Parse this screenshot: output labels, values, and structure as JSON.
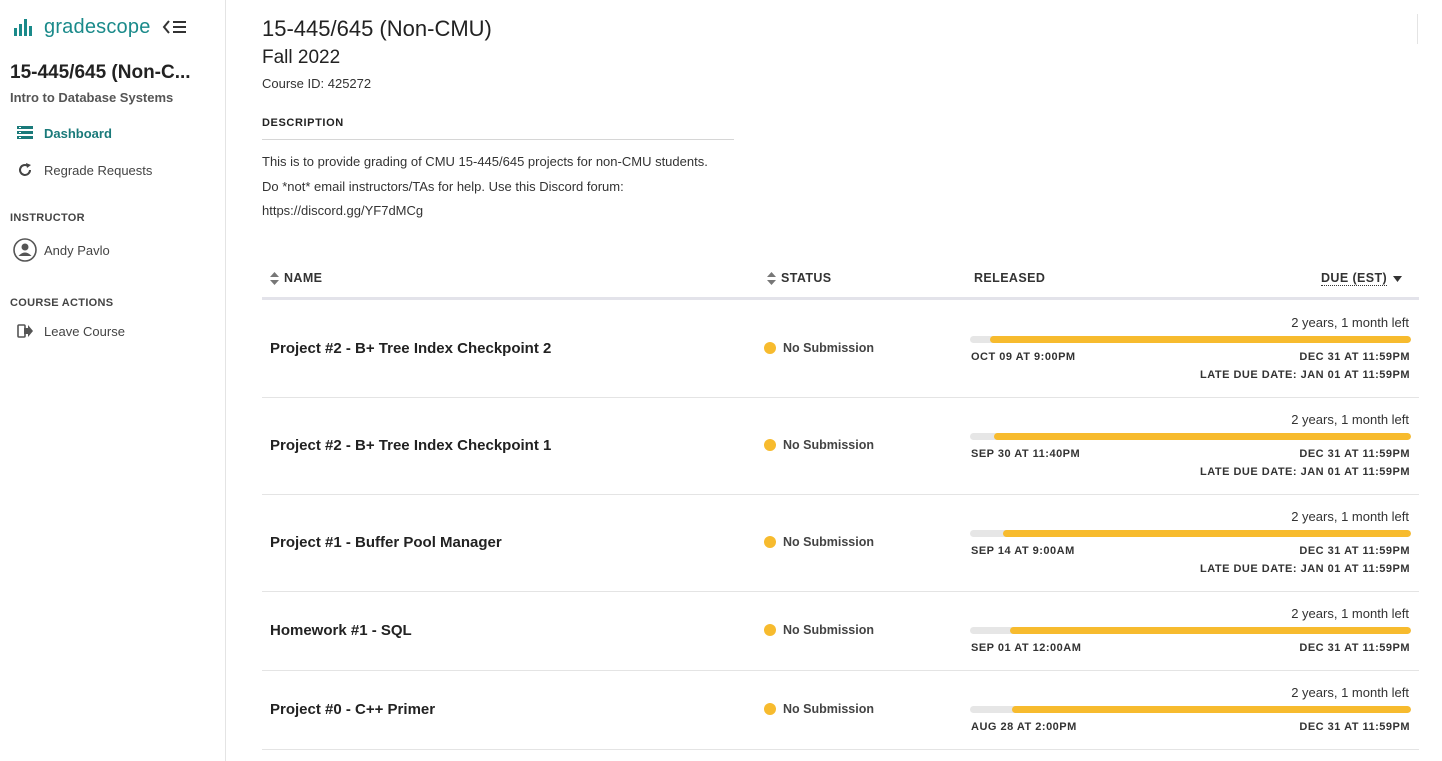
{
  "brand": {
    "name": "gradescope"
  },
  "sidebar": {
    "course_title": "15-445/645 (Non-C...",
    "course_subtitle": "Intro to Database Systems",
    "nav": [
      {
        "label": "Dashboard",
        "icon": "dashboard-icon",
        "active": true
      },
      {
        "label": "Regrade Requests",
        "icon": "refresh-icon",
        "active": false
      }
    ],
    "instructor_heading": "INSTRUCTOR",
    "instructor_name": "Andy Pavlo",
    "actions_heading": "COURSE ACTIONS",
    "leave_label": "Leave Course"
  },
  "course": {
    "title": "15-445/645 (Non-CMU)",
    "term": "Fall 2022",
    "course_id": "Course ID: 425272",
    "description_heading": "DESCRIPTION",
    "description": "This is to provide grading of CMU 15-445/645 projects for non-CMU students. Do *not* email instructors/TAs for help. Use this Discord forum: https://discord.gg/YF7dMCg"
  },
  "table": {
    "headers": {
      "name": "NAME",
      "status": "STATUS",
      "released": "RELEASED",
      "due": "DUE (EST)"
    },
    "rows": [
      {
        "name": "Project #2 - B+ Tree Index Checkpoint 2",
        "status": "No Submission",
        "time_left": "2 years, 1 month left",
        "released": "OCT 09 AT 9:00PM",
        "due": "DEC 31 AT 11:59PM",
        "late_due": "LATE DUE DATE: JAN 01 AT 11:59PM",
        "elapsed_fraction": 0.045
      },
      {
        "name": "Project #2 - B+ Tree Index Checkpoint 1",
        "status": "No Submission",
        "time_left": "2 years, 1 month left",
        "released": "SEP 30 AT 11:40PM",
        "due": "DEC 31 AT 11:59PM",
        "late_due": "LATE DUE DATE: JAN 01 AT 11:59PM",
        "elapsed_fraction": 0.055
      },
      {
        "name": "Project #1 - Buffer Pool Manager",
        "status": "No Submission",
        "time_left": "2 years, 1 month left",
        "released": "SEP 14 AT 9:00AM",
        "due": "DEC 31 AT 11:59PM",
        "late_due": "LATE DUE DATE: JAN 01 AT 11:59PM",
        "elapsed_fraction": 0.075
      },
      {
        "name": "Homework #1 - SQL",
        "status": "No Submission",
        "time_left": "2 years, 1 month left",
        "released": "SEP 01 AT 12:00AM",
        "due": "DEC 31 AT 11:59PM",
        "late_due": "",
        "elapsed_fraction": 0.09
      },
      {
        "name": "Project #0 - C++ Primer",
        "status": "No Submission",
        "time_left": "2 years, 1 month left",
        "released": "AUG 28 AT 2:00PM",
        "due": "DEC 31 AT 11:59PM",
        "late_due": "",
        "elapsed_fraction": 0.095
      }
    ]
  },
  "colors": {
    "accent": "#1a8a8a",
    "status_dot": "#f7bb2e",
    "bar_fill": "#f7bb2e",
    "bar_track": "#e6e6e6"
  }
}
